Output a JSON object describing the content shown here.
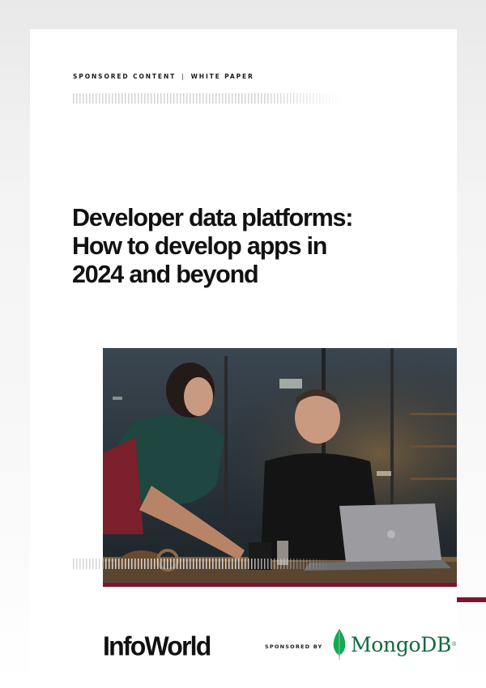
{
  "eyebrow": {
    "left": "SPONSORED CONTENT",
    "separator": "|",
    "right": "WHITE PAPER"
  },
  "headline": {
    "line1": "Developer data platforms:",
    "line2": "How to develop apps in",
    "line3": "2024 and beyond"
  },
  "footer": {
    "publisher_logo_text": "InfoWorld",
    "sponsored_label": "SPONSORED BY",
    "sponsor_logo_text": "MongoDB",
    "sponsor_trademark": "®"
  },
  "colors": {
    "accent": "#7d1430",
    "sponsor_green": "#0f6a3c",
    "text": "#111111"
  }
}
